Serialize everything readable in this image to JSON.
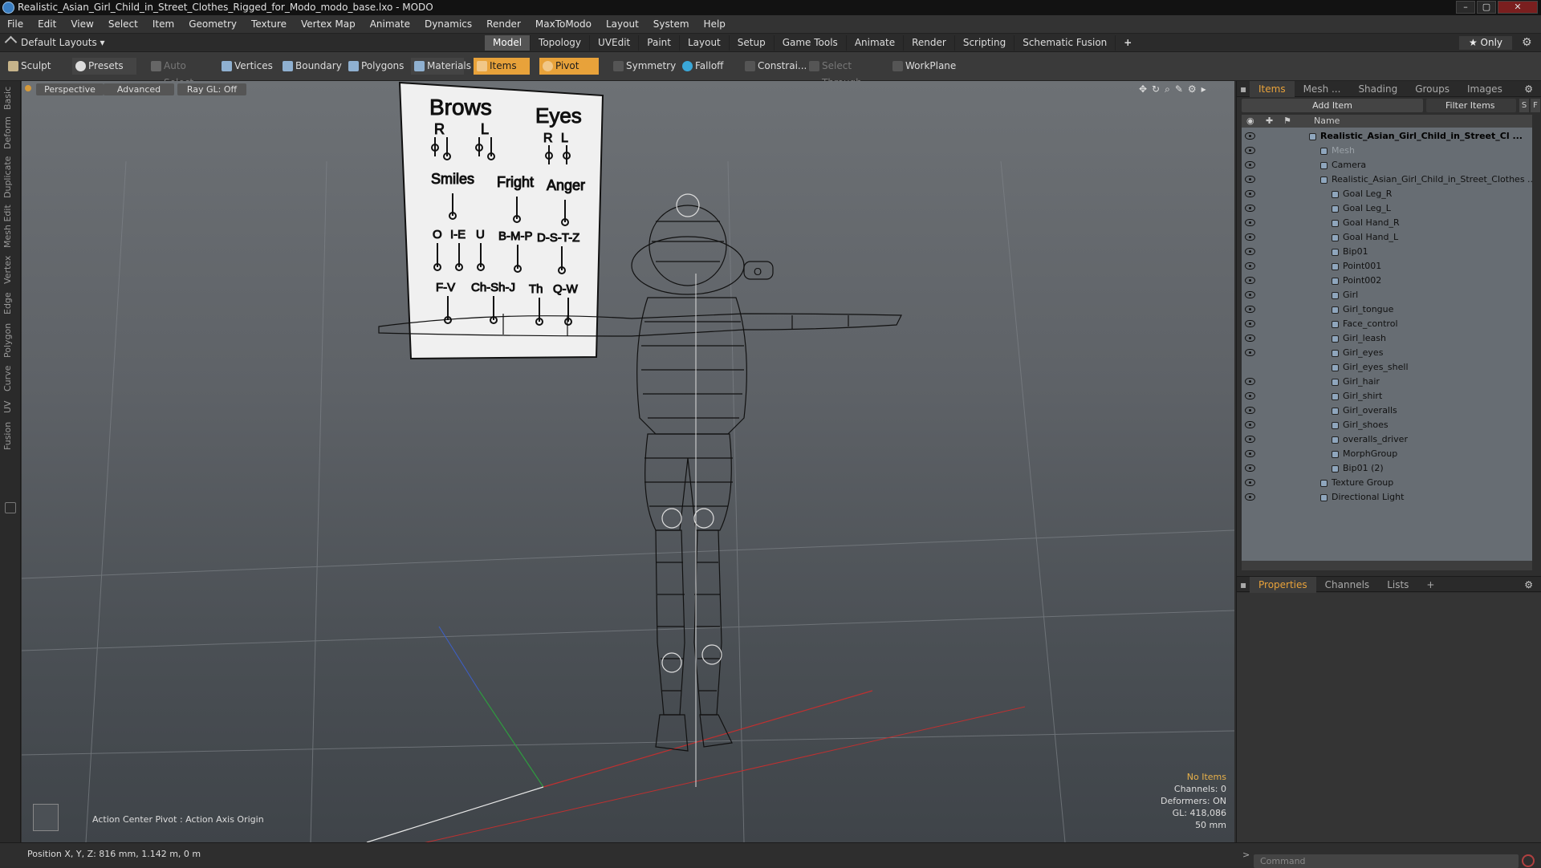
{
  "window": {
    "title": "Realistic_Asian_Girl_Child_in_Street_Clothes_Rigged_for_Modo_modo_base.lxo - MODO",
    "minimize": "–",
    "maximize": "▢",
    "close": "✕"
  },
  "menu": [
    "File",
    "Edit",
    "View",
    "Select",
    "Item",
    "Geometry",
    "Texture",
    "Vertex Map",
    "Animate",
    "Dynamics",
    "Render",
    "MaxToModo",
    "Layout",
    "System",
    "Help"
  ],
  "modebar": {
    "layout": "Default Layouts ▾",
    "tabs": [
      "Model",
      "Topology",
      "UVEdit",
      "Paint",
      "Layout",
      "Setup",
      "Game Tools",
      "Animate",
      "Render",
      "Scripting",
      "Schematic Fusion"
    ],
    "active_tab": "Model",
    "plus": "+",
    "only": "★ Only"
  },
  "toolbar": {
    "sculpt": "Sculpt",
    "presets": "Presets",
    "auto_select": "Auto Select",
    "vertices": "Vertices",
    "boundary": "Boundary",
    "polygons": "Polygons",
    "materials": "Materials",
    "items": "Items",
    "pivot": "Pivot",
    "symmetry": "Symmetry",
    "falloff": "Falloff",
    "constrain": "Constrai...",
    "select_through": "Select Through",
    "workplane": "WorkPlane"
  },
  "left_tabs": [
    "Basic",
    "Deform",
    "Duplicate",
    "Mesh Edit",
    "Vertex",
    "Edge",
    "Polygon",
    "Curve",
    "UV",
    "Fusion"
  ],
  "viewport": {
    "view": "Perspective",
    "advanced": "Advanced",
    "raygl": "Ray GL: Off",
    "action_center": "Action Center Pivot : Action Axis Origin",
    "info": {
      "no_items": "No Items",
      "channels": "Channels: 0",
      "deformers": "Deformers: ON",
      "gl": "GL: 418,086",
      "scale": "50 mm"
    },
    "panel": {
      "brows": "Brows",
      "eyes": "Eyes",
      "r": "R",
      "l": "L",
      "smiles": "Smiles",
      "fright": "Fright",
      "anger": "Anger",
      "o": "O",
      "ie": "I-E",
      "u": "U",
      "bmp": "B-M-P",
      "dstz": "D-S-T-Z",
      "fv": "F-V",
      "chshj": "Ch-Sh-J",
      "th": "Th",
      "qw": "Q-W",
      "mouth_o": "O"
    }
  },
  "status": {
    "position": "Position X, Y, Z:   816 mm, 1.142 m, 0 m"
  },
  "right_panel": {
    "tabs": [
      "Items",
      "Mesh ...",
      "Shading",
      "Groups",
      "Images"
    ],
    "active_tab": "Items",
    "add_item": "Add Item",
    "filter": "Filter Items",
    "s_btn": "S",
    "f_btn": "F",
    "name_header": "Name",
    "items": [
      {
        "label": "Realistic_Asian_Girl_Child_in_Street_Cl ...",
        "style": "bold",
        "eye": true
      },
      {
        "label": "Mesh",
        "style": "dim",
        "eye": true
      },
      {
        "label": "Camera",
        "style": "",
        "eye": true
      },
      {
        "label": "Realistic_Asian_Girl_Child_in_Street_Clothes ...",
        "style": "",
        "eye": true
      },
      {
        "label": "Goal Leg_R",
        "style": "",
        "eye": true
      },
      {
        "label": "Goal Leg_L",
        "style": "",
        "eye": true
      },
      {
        "label": "Goal Hand_R",
        "style": "",
        "eye": true
      },
      {
        "label": "Goal Hand_L",
        "style": "",
        "eye": true
      },
      {
        "label": "Bip01",
        "style": "",
        "eye": true
      },
      {
        "label": "Point001",
        "style": "",
        "eye": true
      },
      {
        "label": "Point002",
        "style": "",
        "eye": true
      },
      {
        "label": "Girl",
        "style": "",
        "eye": true
      },
      {
        "label": "Girl_tongue",
        "style": "",
        "eye": true
      },
      {
        "label": "Face_control",
        "style": "",
        "eye": true
      },
      {
        "label": "Girl_leash",
        "style": "",
        "eye": true
      },
      {
        "label": "Girl_eyes",
        "style": "",
        "eye": true
      },
      {
        "label": "Girl_eyes_shell",
        "style": "",
        "eye": false
      },
      {
        "label": "Girl_hair",
        "style": "",
        "eye": true
      },
      {
        "label": "Girl_shirt",
        "style": "",
        "eye": true
      },
      {
        "label": "Girl_overalls",
        "style": "",
        "eye": true
      },
      {
        "label": "Girl_shoes",
        "style": "",
        "eye": true
      },
      {
        "label": "overalls_driver",
        "style": "",
        "eye": true
      },
      {
        "label": "MorphGroup",
        "style": "",
        "eye": true
      },
      {
        "label": "Bip01 (2)",
        "style": "",
        "eye": true
      },
      {
        "label": "Texture Group",
        "style": "",
        "eye": true
      },
      {
        "label": "Directional Light",
        "style": "",
        "eye": true
      }
    ],
    "props_tabs": [
      "Properties",
      "Channels",
      "Lists"
    ],
    "props_plus": "+",
    "command": "Command"
  },
  "colors": {
    "accent": "#e8a23a",
    "list_bg": "#676d73"
  }
}
